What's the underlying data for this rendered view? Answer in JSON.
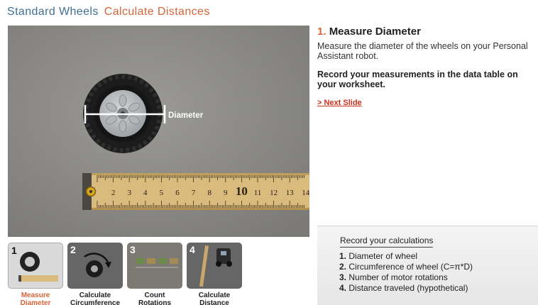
{
  "header": {
    "part1": "Standard Wheels",
    "part2": "Calculate Distances"
  },
  "stage": {
    "diameter_label": "Diameter",
    "ruler_numbers": [
      "2",
      "3",
      "4",
      "5",
      "6",
      "7",
      "8",
      "9",
      "10",
      "11",
      "12",
      "13",
      "14"
    ]
  },
  "step": {
    "number": "1.",
    "title": "Measure Diameter",
    "description": "Measure the diameter of the wheels on your Personal Assistant robot.",
    "record": "Record your measurements in the data table on your worksheet.",
    "next_link": "> Next Slide"
  },
  "calc": {
    "heading": "Record your calculations",
    "items": [
      {
        "num": "1.",
        "text": "Diameter of wheel"
      },
      {
        "num": "2.",
        "text": "Circumference of wheel (C=π*D)"
      },
      {
        "num": "3.",
        "text": "Number of motor rotations"
      },
      {
        "num": "4.",
        "text": "Distance traveled (hypothetical)"
      }
    ]
  },
  "thumbnails": [
    {
      "num": "1",
      "line1": "Measure",
      "line2": "Diameter",
      "active": true
    },
    {
      "num": "2",
      "line1": "Calculate",
      "line2": "Circumference",
      "active": false
    },
    {
      "num": "3",
      "line1": "Count",
      "line2": "Rotations",
      "active": false
    },
    {
      "num": "4",
      "line1": "Calculate",
      "line2": "Distance",
      "active": false
    }
  ],
  "colors": {
    "accent_orange": "#d6633a",
    "title_blue": "#3f6f93",
    "link_red": "#cc2e1f"
  }
}
